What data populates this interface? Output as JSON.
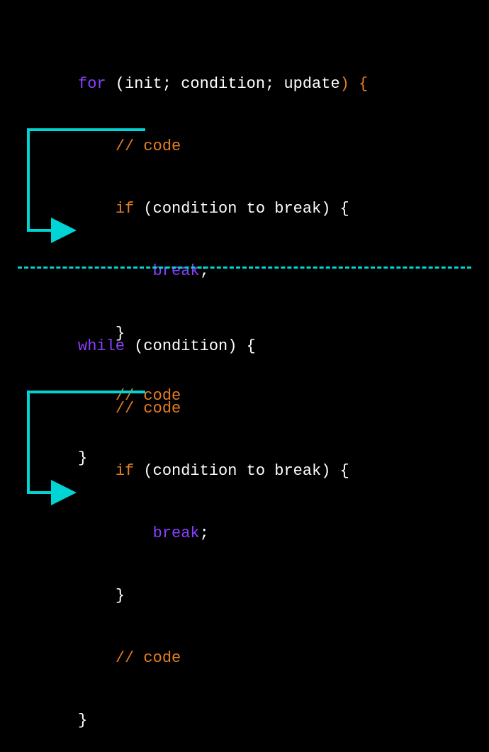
{
  "colors": {
    "keyword_purple": "#8a3fff",
    "keyword_orange": "#e67e22",
    "text_white": "#ffffff",
    "arrow_cyan": "#00d4d4",
    "background": "#000000"
  },
  "block1": {
    "line1_for": "for",
    "line1_init": " (init; condition; update",
    "line1_close": ") {",
    "line2_comment": "// code",
    "line3_if": "if",
    "line3_cond": " (condition to break) {",
    "line4_break": "break",
    "line4_semi": ";",
    "line5_close": "}",
    "line6_comment": "// code",
    "line7_close": "}"
  },
  "block2": {
    "line1_while": "while",
    "line1_cond": " (condition) {",
    "line2_comment": "// code",
    "line3_if": "if",
    "line3_cond": " (condition to break) {",
    "line4_break": "break",
    "line4_semi": ";",
    "line5_close": "}",
    "line6_comment": "// code",
    "line7_close": "}"
  }
}
